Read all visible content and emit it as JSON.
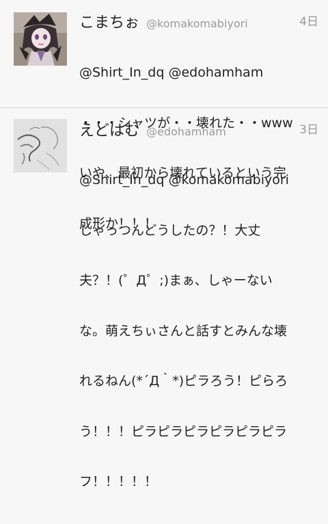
{
  "tweets": [
    {
      "display_name": "こまちぉ",
      "handle": "@komakomabiyori",
      "time": "4日",
      "avatar_icon": "anime-character-avatar-icon",
      "lines": [
        "@Shirt_In_dq @edohamham",
        "・・・シャツが・・壊れた・・www",
        "いや、最初から壊れているという完",
        "成形か！！！"
      ]
    },
    {
      "display_name": "えどはむ",
      "handle": "@edohamham",
      "time": "3日",
      "avatar_icon": "sketch-drawing-avatar-icon",
      "lines": [
        "@Shirt_In_dq @komakomabiyori",
        "しゃっつんどうしたの？！大丈",
        "夫？！(゜Д゜;)まぁ、しゃーない",
        "な。萌えちぃさんと話すとみんな壊",
        "れるねん(*´Д｀*)ピラろう！ピらろ",
        "う！！！ピラピラピラピラピラピラ",
        "フ！！！！！"
      ]
    }
  ],
  "colors": {
    "background": "#f7f7f7",
    "name": "#222222",
    "meta": "#9a9a9a",
    "divider": "#d9d9d9"
  }
}
